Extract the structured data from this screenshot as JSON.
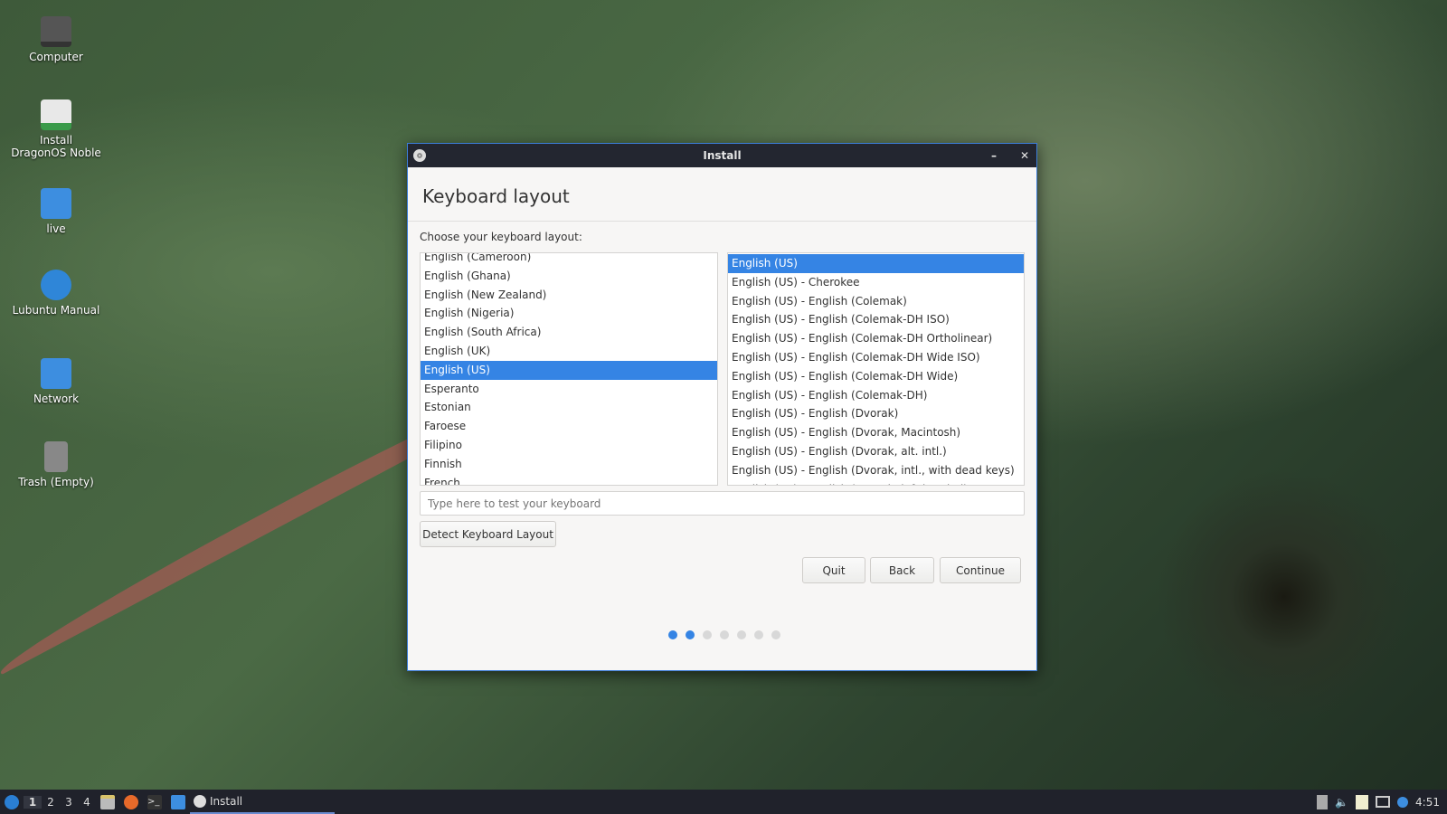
{
  "desktop": {
    "icons": [
      {
        "label": "Computer",
        "icon": "monitor-icon"
      },
      {
        "label": "Install DragonOS Noble",
        "icon": "installer-icon"
      },
      {
        "label": "live",
        "icon": "home-folder-icon"
      },
      {
        "label": "Lubuntu Manual",
        "icon": "manual-icon"
      },
      {
        "label": "Network",
        "icon": "network-folder-icon"
      },
      {
        "label": "Trash (Empty)",
        "icon": "trash-icon"
      }
    ]
  },
  "window": {
    "title": "Install",
    "minimize": "–",
    "close": "✕",
    "heading": "Keyboard layout",
    "choose_label": "Choose your keyboard layout:",
    "languages": [
      "English (Cameroon)",
      "English (Ghana)",
      "English (New Zealand)",
      "English (Nigeria)",
      "English (South Africa)",
      "English (UK)",
      "English (US)",
      "Esperanto",
      "Estonian",
      "Faroese",
      "Filipino",
      "Finnish",
      "French"
    ],
    "selected_language": "English (US)",
    "variants": [
      "English (US)",
      "English (US) - Cherokee",
      "English (US) - English (Colemak)",
      "English (US) - English (Colemak-DH ISO)",
      "English (US) - English (Colemak-DH Ortholinear)",
      "English (US) - English (Colemak-DH Wide ISO)",
      "English (US) - English (Colemak-DH Wide)",
      "English (US) - English (Colemak-DH)",
      "English (US) - English (Dvorak)",
      "English (US) - English (Dvorak, Macintosh)",
      "English (US) - English (Dvorak, alt. intl.)",
      "English (US) - English (Dvorak, intl., with dead keys)",
      "English (US) - English (Dvorak, left-handed)"
    ],
    "selected_variant": "English (US)",
    "test_placeholder": "Type here to test your keyboard",
    "detect_label": "Detect Keyboard Layout",
    "quit_label": "Quit",
    "back_label": "Back",
    "continue_label": "Continue",
    "progress": {
      "total_steps": 7,
      "current_step": 2
    }
  },
  "taskbar": {
    "workspaces": [
      "1",
      "2",
      "3",
      "4"
    ],
    "active_workspace": "1",
    "task_label": "Install",
    "clock": "4:51"
  },
  "colors": {
    "accent": "#3584e4",
    "titlebar": "#232630",
    "taskbar": "#20222b"
  }
}
